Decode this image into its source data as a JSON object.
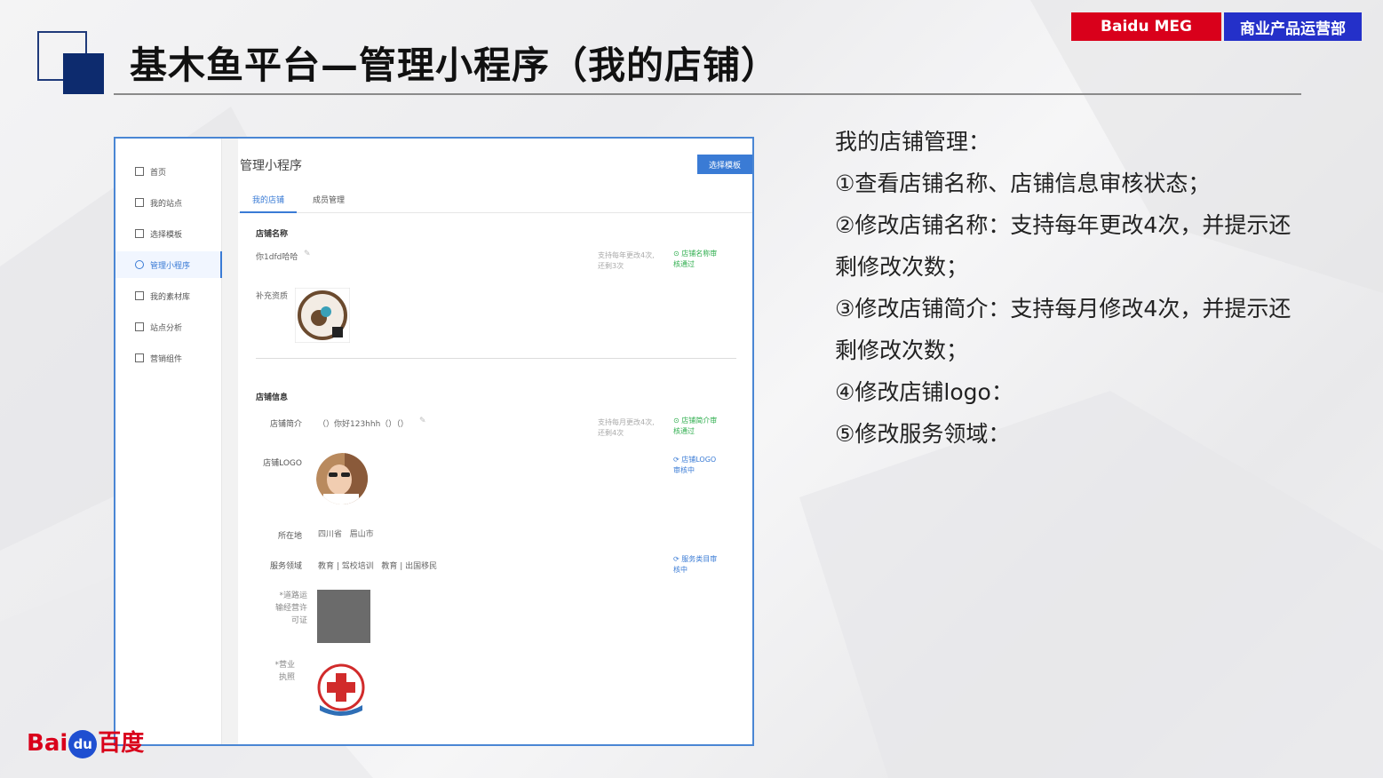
{
  "slide": {
    "title": "基木鱼平台—管理小程序（我的店铺）",
    "badge_left": "Baidu MEG",
    "badge_right": "商业产品运营部",
    "brand": {
      "part1": "Bai",
      "part2": "du",
      "part3": "百度"
    }
  },
  "description": {
    "heading": "我的店铺管理：",
    "lines": [
      "①查看店铺名称、店铺信息审核状态；",
      "②修改店铺名称：支持每年更改4次，并提示还",
      "剩修改次数；",
      "③修改店铺简介：支持每月修改4次，并提示还",
      "剩修改次数；",
      "④修改店铺logo：",
      "⑤修改服务领域："
    ]
  },
  "screenshot": {
    "sidebar": {
      "items": [
        {
          "label": "首页",
          "active": false
        },
        {
          "label": "我的站点",
          "active": false
        },
        {
          "label": "选择模板",
          "active": false
        },
        {
          "label": "管理小程序",
          "active": true
        },
        {
          "label": "我的素材库",
          "active": false
        },
        {
          "label": "站点分析",
          "active": false
        },
        {
          "label": "营销组件",
          "active": false
        }
      ]
    },
    "main_title": "管理小程序",
    "choose_template_button": "选择模板",
    "tabs": [
      {
        "label": "我的店铺",
        "active": true
      },
      {
        "label": "成员管理",
        "active": false
      }
    ],
    "store_name": {
      "section_title": "店铺名称",
      "value": "你1dfd哈哈",
      "hint": "支持每年更改4次,还剩3次",
      "status": "店铺名称审核通过",
      "supplement_label": "补充资质"
    },
    "store_info": {
      "section_title": "店铺信息",
      "intro_label": "店铺简介",
      "intro_value": "（）你好123hhh（）（）",
      "intro_hint": "支持每月更改4次,还剩4次",
      "intro_status": "店铺简介审核通过",
      "logo_label": "店铺LOGO",
      "logo_status": "店铺LOGO审核中",
      "location_label": "所在地",
      "location_value": "四川省   眉山市",
      "service_label": "服务领域",
      "service_value": "教育 | 驾校培训   教育 | 出国移民",
      "service_status": "服务类目审核中",
      "permit_label": "*道路运输经营许可证",
      "license_label": "*营业执照"
    }
  },
  "colors": {
    "accent_blue": "#3a7bd5",
    "status_green": "#2fae4e",
    "badge_red": "#d9001b",
    "badge_blue": "#2430c9",
    "navy": "#0d2b6e"
  }
}
